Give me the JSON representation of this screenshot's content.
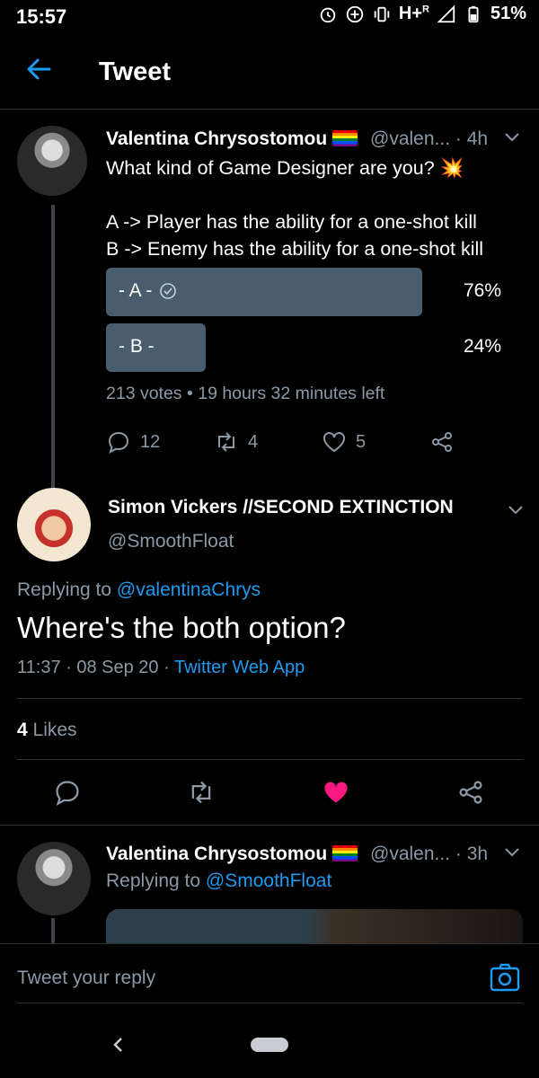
{
  "status_bar": {
    "time": "15:57",
    "network": "H+",
    "network_sup": "R",
    "battery": "51%"
  },
  "header": {
    "title": "Tweet"
  },
  "tweet1": {
    "name": "Valentina Chrysostomou",
    "handle": "@valen...",
    "time": "· 4h",
    "text_line1": "What kind of Game Designer are you? ",
    "text_line1_emoji": "💥",
    "text_line3": "A -> Player has the ability for a one-shot kill",
    "text_line4": "B -> Enemy has the ability for a one-shot kill",
    "poll": {
      "options": [
        {
          "label": "- A -",
          "percent_text": "76%",
          "fraction": 0.76,
          "winner": true
        },
        {
          "label": "- B -",
          "percent_text": "24%",
          "fraction": 0.24,
          "winner": false
        }
      ],
      "meta": "213 votes • 19 hours 32 minutes left"
    },
    "replies": "12",
    "retweets": "4",
    "likes": "5"
  },
  "tweet2": {
    "name": "Simon Vickers //SECOND EXTINCTION",
    "handle": "@SmoothFloat",
    "replying_prefix": "Replying to ",
    "replying_to": "@valentinaChrys",
    "text": "Where's the both option?",
    "timestamp": "11:37 · 08 Sep 20 · ",
    "source": "Twitter Web App",
    "likes_count": "4",
    "likes_label": " Likes",
    "liked": true
  },
  "tweet3": {
    "name": "Valentina Chrysostomou",
    "handle": "@valen...",
    "time": "· 3h",
    "replying_prefix": "Replying to ",
    "replying_to": "@SmoothFloat"
  },
  "composer": {
    "placeholder": "Tweet your reply"
  },
  "colors": {
    "background": "#000000",
    "link": "#1d9bf0",
    "poll_bar": "#4a5d6e",
    "like_active": "#f91880",
    "muted": "#8b98a5"
  }
}
